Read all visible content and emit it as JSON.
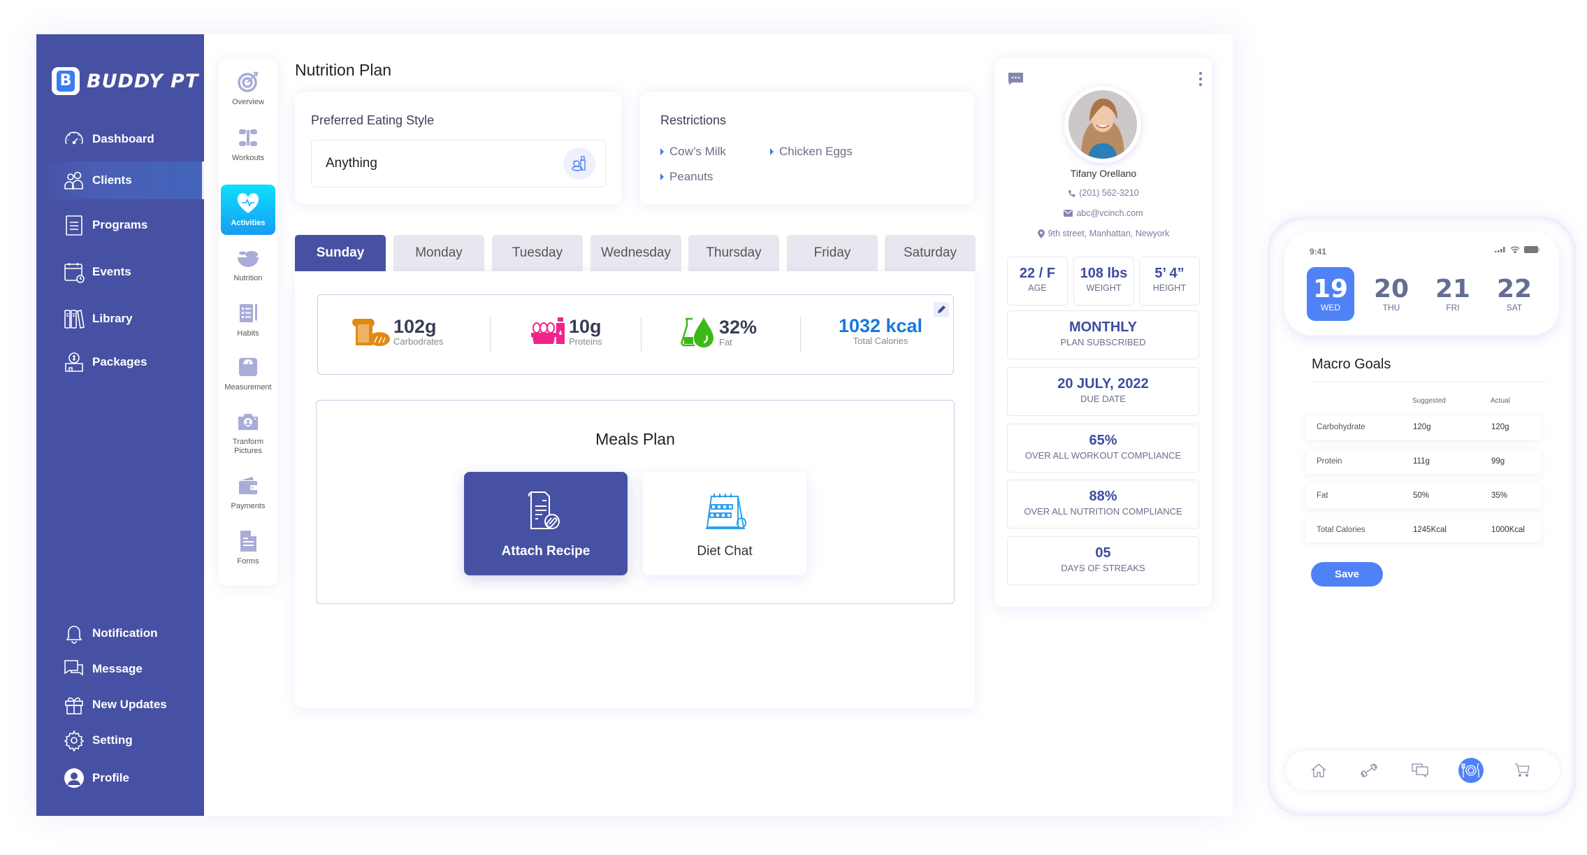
{
  "app": {
    "brand": "BUDDY PT",
    "brand_letter": "B"
  },
  "sidebar": {
    "items": [
      {
        "label": "Dashboard",
        "icon": "speedometer-icon"
      },
      {
        "label": "Clients",
        "icon": "users-icon",
        "active": true
      },
      {
        "label": "Programs",
        "icon": "list-icon"
      },
      {
        "label": "Events",
        "icon": "calendar-clock-icon"
      },
      {
        "label": "Library",
        "icon": "books-icon"
      },
      {
        "label": "Packages",
        "icon": "money-box-icon"
      }
    ],
    "bottom_items": [
      {
        "label": "Notification",
        "icon": "bell-icon"
      },
      {
        "label": "Message",
        "icon": "chat-icon"
      },
      {
        "label": "New Updates",
        "icon": "gift-icon"
      },
      {
        "label": "Setting",
        "icon": "gear-icon"
      },
      {
        "label": "Profile",
        "icon": "user-circle-icon"
      }
    ]
  },
  "subnav": {
    "items": [
      {
        "label": "Overview",
        "icon": "target-icon"
      },
      {
        "label": "Workouts",
        "icon": "dumbbell-icon"
      },
      {
        "label": "Activities",
        "icon": "heart-pulse-icon",
        "active": true
      },
      {
        "label": "Nutrition",
        "icon": "salad-bowl-icon"
      },
      {
        "label": "Habits",
        "icon": "checklist-icon"
      },
      {
        "label": "Measurement",
        "icon": "scale-icon"
      },
      {
        "label": "Tranform Pictures",
        "icon": "camera-icon"
      },
      {
        "label": "Payments",
        "icon": "wallet-icon"
      },
      {
        "label": "Forms",
        "icon": "document-icon"
      }
    ]
  },
  "page": {
    "title": "Nutrition Plan",
    "eating_style": {
      "label": "Preferred Eating Style",
      "value": "Anything"
    },
    "restrictions": {
      "label": "Restrictions",
      "items": [
        "Cow’s Milk",
        "Chicken Eggs",
        "Peanuts"
      ]
    },
    "tabs": [
      "Sunday",
      "Monday",
      "Tuesday",
      "Wednesday",
      "Thursday",
      "Friday",
      "Saturday"
    ],
    "active_tab": "Sunday",
    "macros": [
      {
        "value": "102g",
        "label": "Carbodrates",
        "icon": "bread-icon",
        "color": "#e08a12"
      },
      {
        "value": "10g",
        "label": "Proteins",
        "icon": "eggs-milk-icon",
        "color": "#f0238c"
      },
      {
        "value": "32%",
        "label": "Fat",
        "icon": "oil-drop-icon",
        "color": "#3cb918"
      }
    ],
    "total_calories": {
      "value": "1032 kcal",
      "label": "Total Calories",
      "color": "#1778e0"
    },
    "meals": {
      "title": "Meals Plan",
      "attach_label": "Attach Recipe",
      "diet_label": "Diet Chat"
    }
  },
  "profile": {
    "name": "Tifany Orellano",
    "phone": "(201) 562-3210",
    "email": "abc@vcinch.com",
    "address": "9th street, Manhattan, Newyork",
    "stats_small": [
      {
        "value": "22 / F",
        "label": "AGE"
      },
      {
        "value": "108 lbs",
        "label": "WEIGHT"
      },
      {
        "value": "5’ 4”",
        "label": "HEIGHT"
      }
    ],
    "stats_wide": [
      {
        "value": "MONTHLY",
        "label": "PLAN SUBSCRIBED"
      },
      {
        "value": "20 JULY, 2022",
        "label": "DUE DATE"
      },
      {
        "value": "65%",
        "label": "OVER ALL WORKOUT COMPLIANCE"
      },
      {
        "value": "88%",
        "label": "OVER ALL NUTRITION COMPLIANCE"
      },
      {
        "value": "05",
        "label": "DAYS OF STREAKS"
      }
    ]
  },
  "phone": {
    "time": "9:41",
    "days": [
      {
        "num": "19",
        "day": "WED",
        "active": true
      },
      {
        "num": "20",
        "day": "THU"
      },
      {
        "num": "21",
        "day": "FRI"
      },
      {
        "num": "22",
        "day": "SAT"
      }
    ],
    "macro_goals": {
      "title": "Macro Goals",
      "headers": [
        "Suggested",
        "Actual"
      ],
      "rows": [
        {
          "name": "Carbohydrate",
          "suggested": "120g",
          "actual": "120g"
        },
        {
          "name": "Protein",
          "suggested": "111g",
          "actual": "99g"
        },
        {
          "name": "Fat",
          "suggested": "50%",
          "actual": "35%"
        },
        {
          "name": "Total Calories",
          "suggested": "1245Kcal",
          "actual": "1000Kcal"
        }
      ]
    },
    "save_label": "Save",
    "nav": [
      {
        "icon": "home-icon"
      },
      {
        "icon": "dumbbell-icon"
      },
      {
        "icon": "chat-icon"
      },
      {
        "icon": "plate-cutlery-icon",
        "active": true
      },
      {
        "icon": "cart-icon"
      }
    ]
  },
  "colors": {
    "sidebar": "#4751a3",
    "accent": "#4f82f7",
    "activities_gradient": [
      "#0be0fb",
      "#1a9bf4"
    ],
    "stat_value": "#3f4ba0"
  }
}
